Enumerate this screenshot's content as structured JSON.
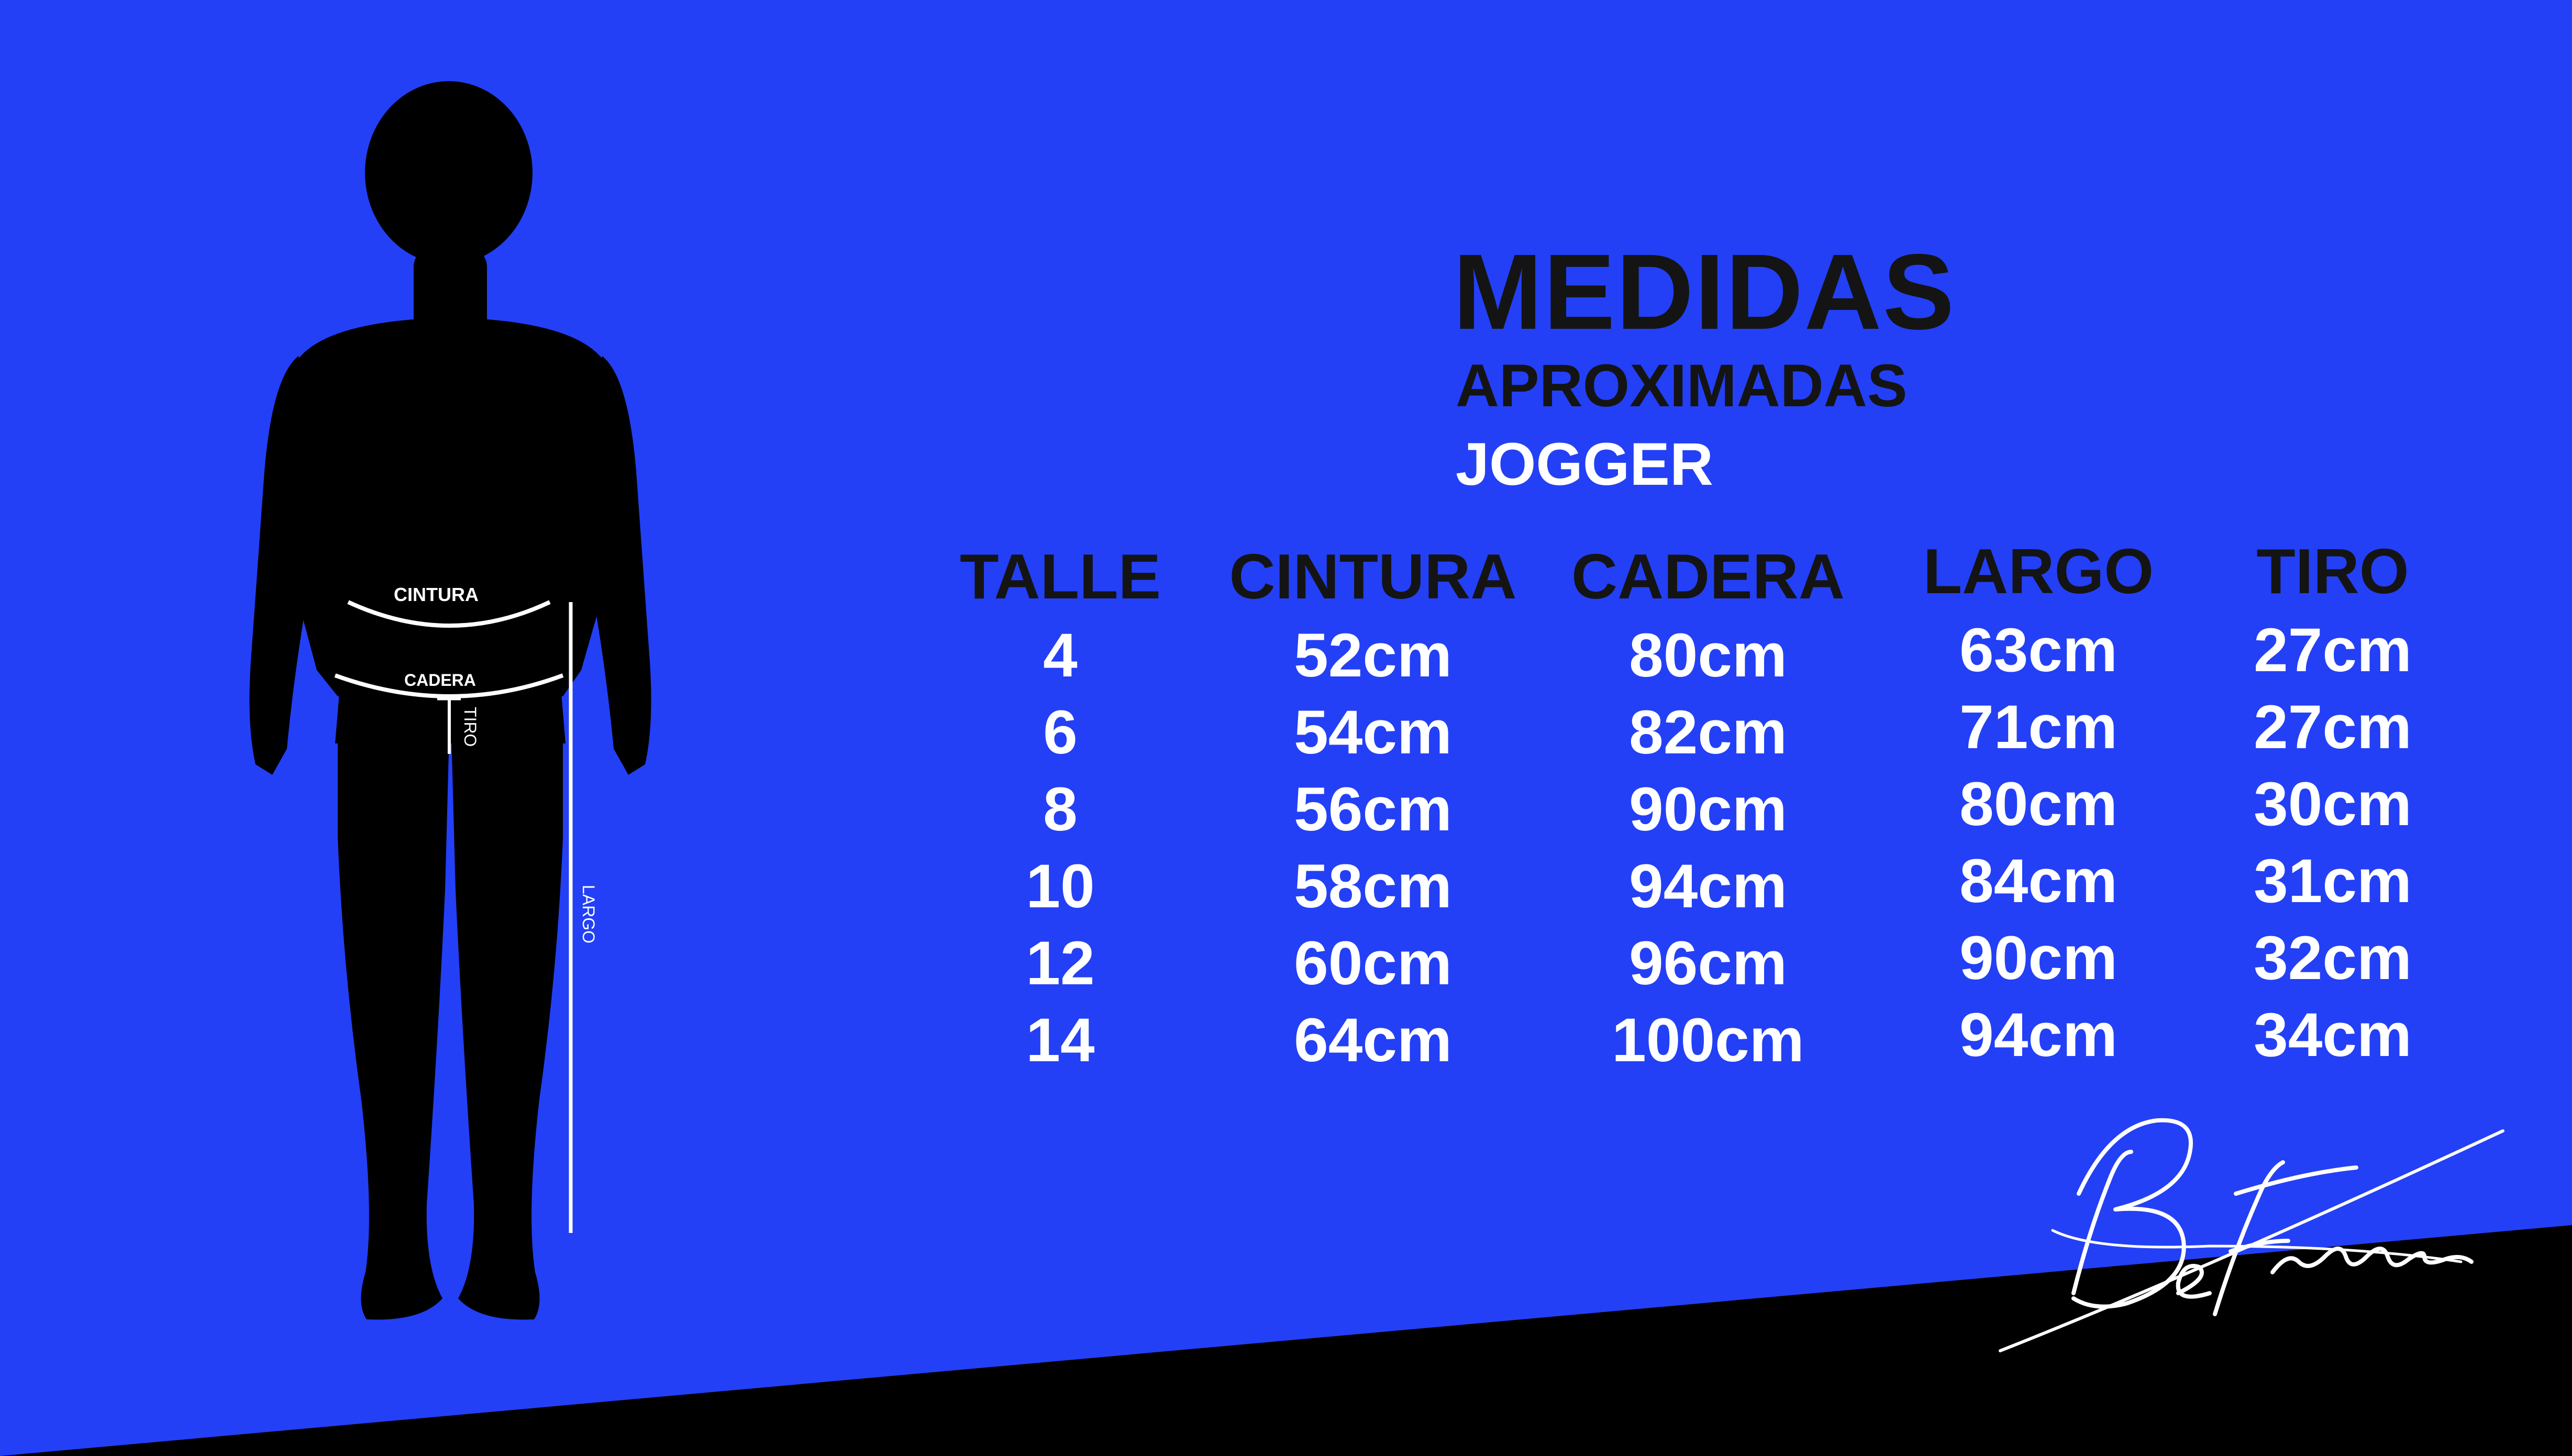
{
  "heading": {
    "title": "MEDIDAS",
    "subtitle": "APROXIMADAS",
    "product": "JOGGER"
  },
  "figure_labels": {
    "waist": "CINTURA",
    "hip": "CADERA",
    "rise": "TIRO",
    "length": "LARGO"
  },
  "table": {
    "headers": [
      "TALLE",
      "CINTURA",
      "CADERA",
      "LARGO",
      "TIRO"
    ],
    "rows": [
      [
        "4",
        "52cm",
        "80cm",
        "63cm",
        "27cm"
      ],
      [
        "6",
        "54cm",
        "82cm",
        "71cm",
        "27cm"
      ],
      [
        "8",
        "56cm",
        "90cm",
        "80cm",
        "30cm"
      ],
      [
        "10",
        "58cm",
        "94cm",
        "84cm",
        "31cm"
      ],
      [
        "12",
        "60cm",
        "96cm",
        "90cm",
        "32cm"
      ],
      [
        "14",
        "64cm",
        "100cm",
        "94cm",
        "34cm"
      ]
    ]
  },
  "brand": {
    "signature_text": "BeFree",
    "logo_type": "handwritten-signature"
  },
  "colors": {
    "background": "#2340f6",
    "dark": "#141414",
    "white": "#ffffff",
    "footer_band": "#000000"
  }
}
